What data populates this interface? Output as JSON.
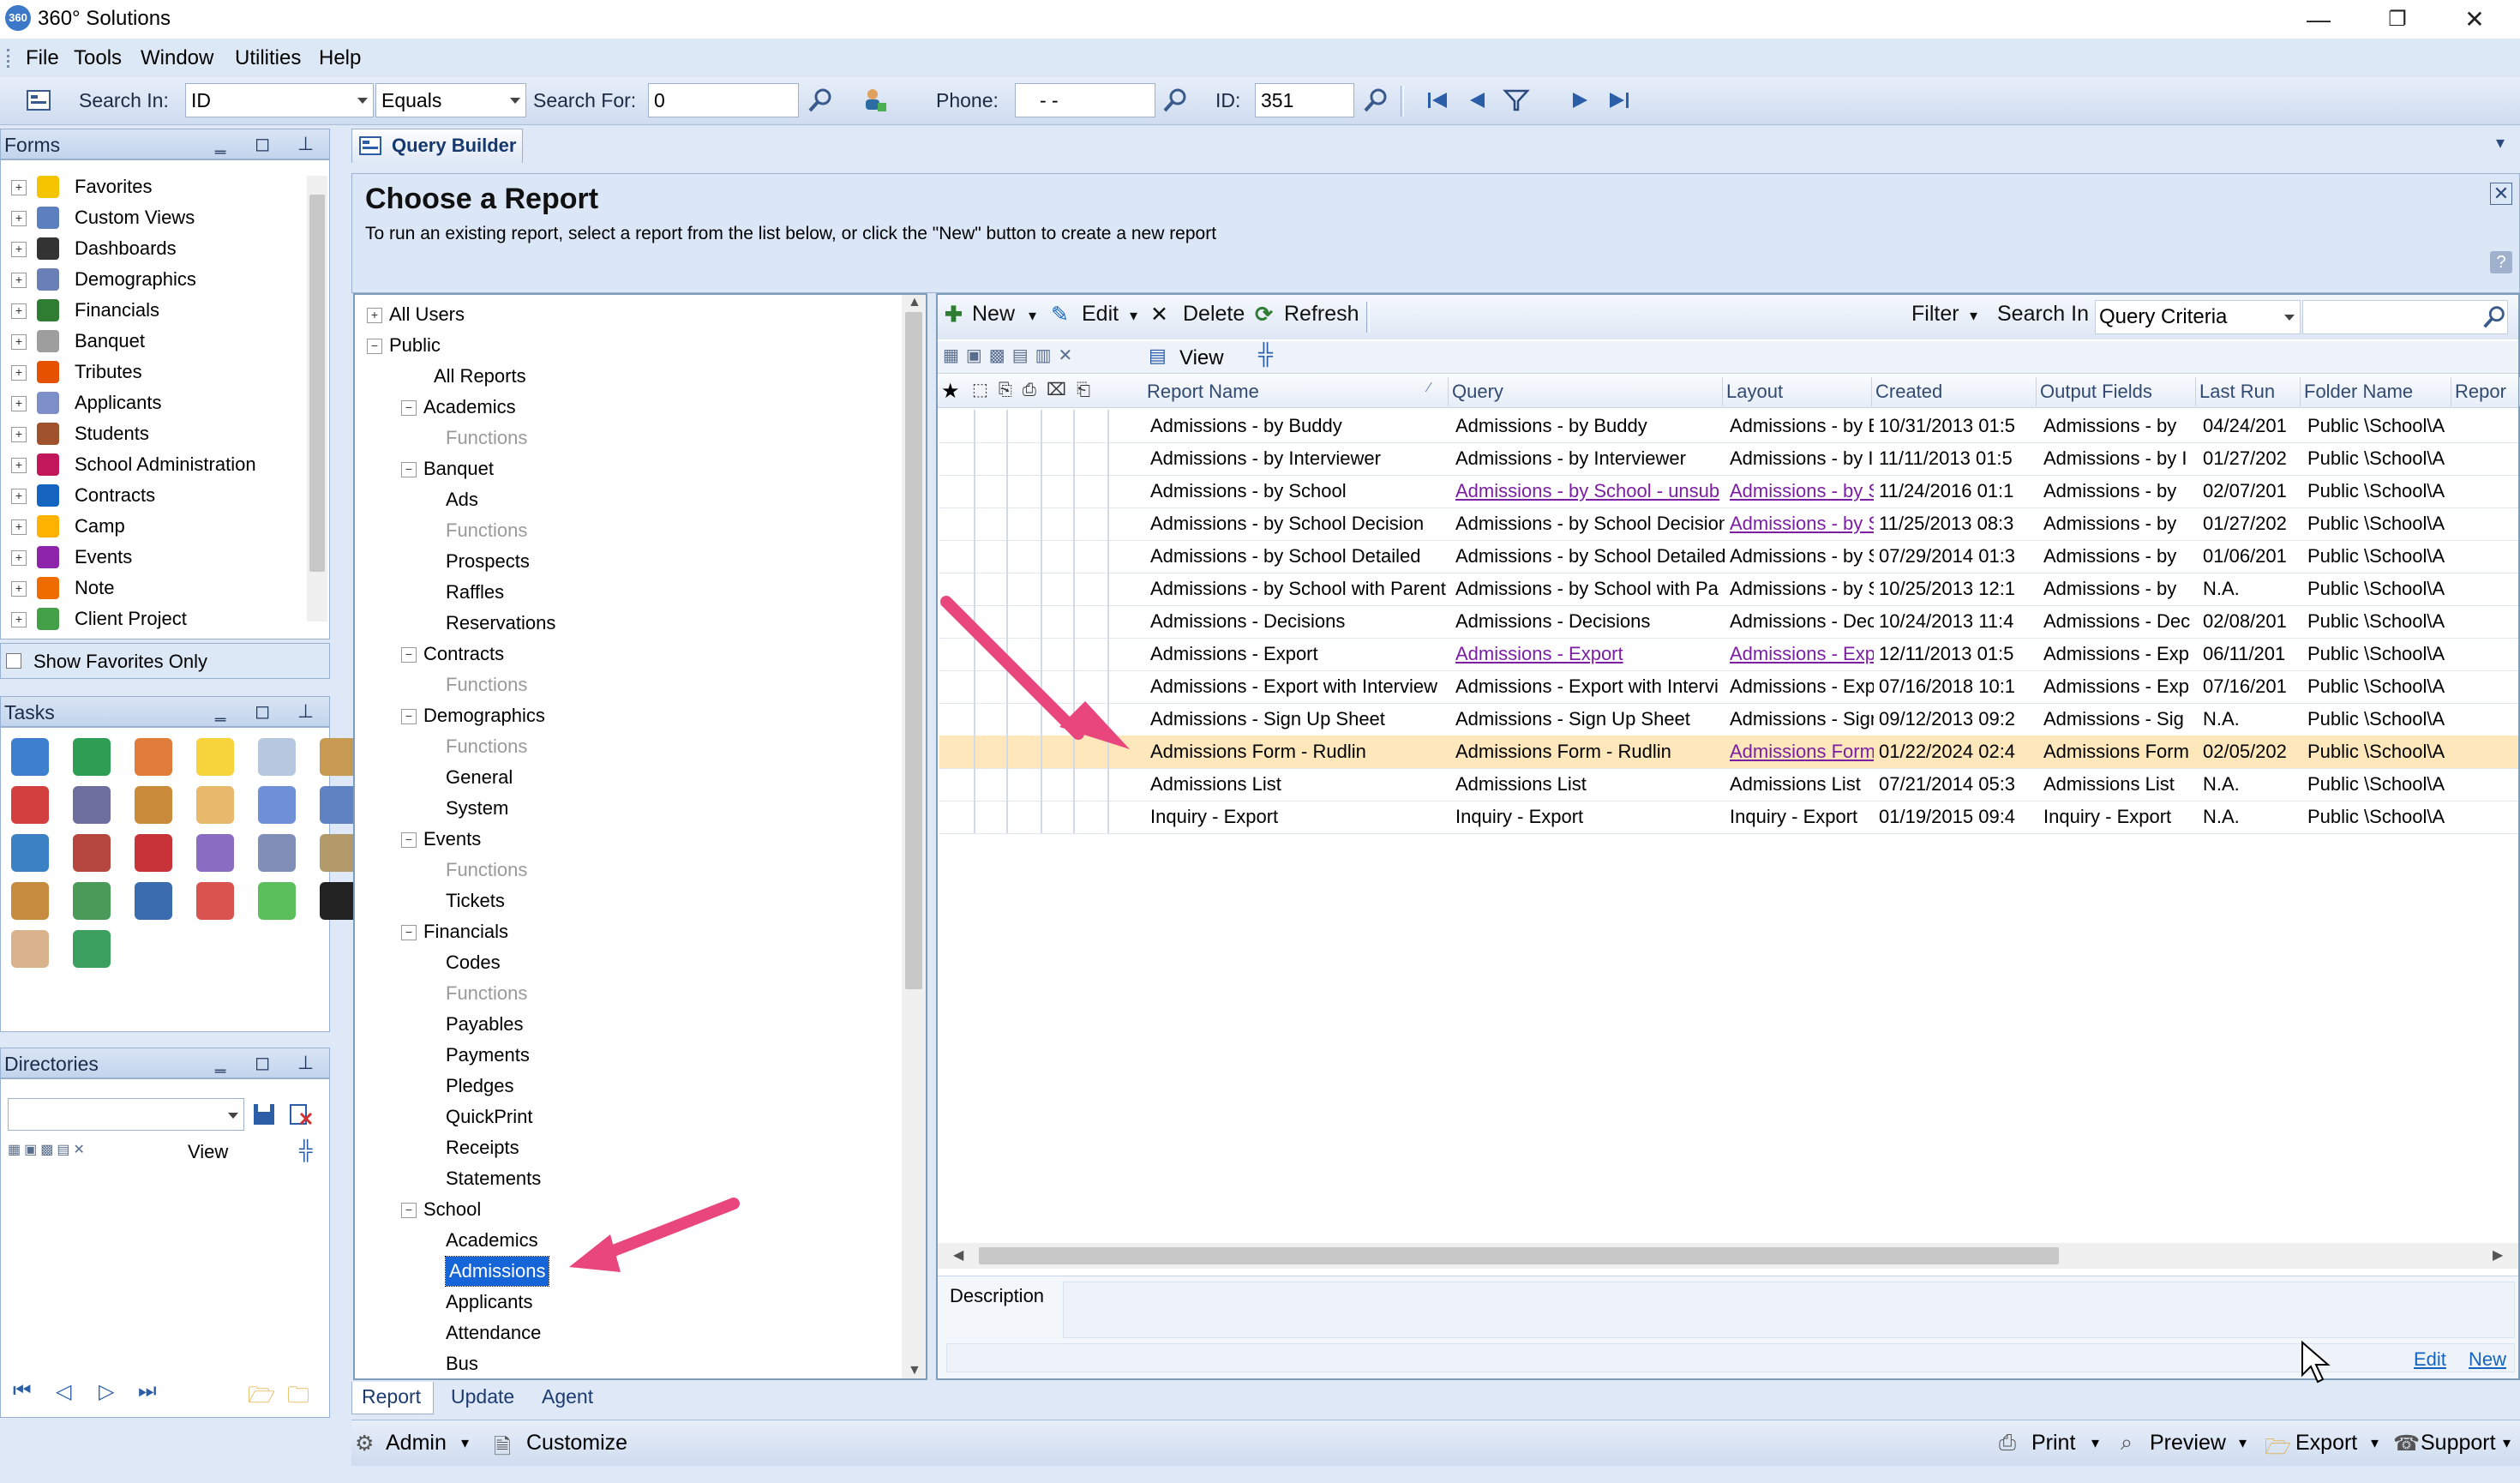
{
  "window": {
    "title": "360° Solutions",
    "minimize": "—",
    "restore": "❐",
    "close": "✕"
  },
  "menu": [
    "File",
    "Tools",
    "Window",
    "Utilities",
    "Help"
  ],
  "toolbar": {
    "search_in_label": "Search In:",
    "search_in_value": "ID",
    "operator_value": "Equals",
    "search_for_label": "Search For:",
    "search_for_value": "0",
    "phone_label": "Phone:",
    "phone_value": "-   -",
    "id_label": "ID:",
    "id_value": "351"
  },
  "forms_panel": {
    "title": "Forms",
    "items": [
      {
        "label": "Favorites",
        "icon": "star-icon",
        "color": "#f5c400"
      },
      {
        "label": "Custom Views",
        "icon": "custom-views-icon",
        "color": "#5b7fbf"
      },
      {
        "label": "Dashboards",
        "icon": "dashboard-icon",
        "color": "#333333"
      },
      {
        "label": "Demographics",
        "icon": "demographics-icon",
        "color": "#6a7fb5"
      },
      {
        "label": "Financials",
        "icon": "dollar-icon",
        "color": "#2e7d32"
      },
      {
        "label": "Banquet",
        "icon": "banquet-icon",
        "color": "#9e9e9e"
      },
      {
        "label": "Tributes",
        "icon": "tributes-icon",
        "color": "#e65100"
      },
      {
        "label": "Applicants",
        "icon": "applicants-icon",
        "color": "#7c8fc9"
      },
      {
        "label": "Students",
        "icon": "students-icon",
        "color": "#a0522d"
      },
      {
        "label": "School Administration",
        "icon": "school-admin-icon",
        "color": "#c2185b"
      },
      {
        "label": "Contracts",
        "icon": "contracts-icon",
        "color": "#1565c0"
      },
      {
        "label": "Camp",
        "icon": "camp-icon",
        "color": "#ffb300"
      },
      {
        "label": "Events",
        "icon": "events-icon",
        "color": "#8e24aa"
      },
      {
        "label": "Note",
        "icon": "note-icon",
        "color": "#ef6c00"
      },
      {
        "label": "Client Project",
        "icon": "client-project-icon",
        "color": "#43a047"
      }
    ],
    "show_favorites_only": "Show Favorites Only"
  },
  "tasks_panel": {
    "title": "Tasks"
  },
  "directories_panel": {
    "title": "Directories",
    "view_label": "View"
  },
  "tab": {
    "label": "Query Builder"
  },
  "chooser": {
    "title": "Choose a Report",
    "subtitle": "To run an existing report, select a report from the list below, or click the \"New\" button to create a new report"
  },
  "tree": [
    {
      "label": "All Users",
      "level": 0,
      "exp": "+"
    },
    {
      "label": "Public",
      "level": 0,
      "exp": "−"
    },
    {
      "label": "All Reports",
      "level": 1,
      "exp": ""
    },
    {
      "label": "Academics",
      "level": 1,
      "exp": "−"
    },
    {
      "label": "Functions",
      "level": 2,
      "exp": "",
      "grey": true
    },
    {
      "label": "Banquet",
      "level": 1,
      "exp": "−"
    },
    {
      "label": "Ads",
      "level": 2,
      "exp": ""
    },
    {
      "label": "Functions",
      "level": 2,
      "exp": "",
      "grey": true
    },
    {
      "label": "Prospects",
      "level": 2,
      "exp": ""
    },
    {
      "label": "Raffles",
      "level": 2,
      "exp": ""
    },
    {
      "label": "Reservations",
      "level": 2,
      "exp": ""
    },
    {
      "label": "Contracts",
      "level": 1,
      "exp": "−"
    },
    {
      "label": "Functions",
      "level": 2,
      "exp": "",
      "grey": true
    },
    {
      "label": "Demographics",
      "level": 1,
      "exp": "−"
    },
    {
      "label": "Functions",
      "level": 2,
      "exp": "",
      "grey": true
    },
    {
      "label": "General",
      "level": 2,
      "exp": ""
    },
    {
      "label": "System",
      "level": 2,
      "exp": ""
    },
    {
      "label": "Events",
      "level": 1,
      "exp": "−"
    },
    {
      "label": "Functions",
      "level": 2,
      "exp": "",
      "grey": true
    },
    {
      "label": "Tickets",
      "level": 2,
      "exp": ""
    },
    {
      "label": "Financials",
      "level": 1,
      "exp": "−"
    },
    {
      "label": "Codes",
      "level": 2,
      "exp": ""
    },
    {
      "label": "Functions",
      "level": 2,
      "exp": "",
      "grey": true
    },
    {
      "label": "Payables",
      "level": 2,
      "exp": ""
    },
    {
      "label": "Payments",
      "level": 2,
      "exp": ""
    },
    {
      "label": "Pledges",
      "level": 2,
      "exp": ""
    },
    {
      "label": "QuickPrint",
      "level": 2,
      "exp": ""
    },
    {
      "label": "Receipts",
      "level": 2,
      "exp": ""
    },
    {
      "label": "Statements",
      "level": 2,
      "exp": ""
    },
    {
      "label": "School",
      "level": 1,
      "exp": "−"
    },
    {
      "label": "Academics",
      "level": 2,
      "exp": ""
    },
    {
      "label": "Admissions",
      "level": 2,
      "exp": "",
      "selected": true
    },
    {
      "label": "Applicants",
      "level": 2,
      "exp": ""
    },
    {
      "label": "Attendance",
      "level": 2,
      "exp": ""
    },
    {
      "label": "Bus",
      "level": 2,
      "exp": ""
    }
  ],
  "grid_toolbar": {
    "new": "New",
    "edit": "Edit",
    "delete": "Delete",
    "refresh": "Refresh",
    "filter": "Filter",
    "search_in": "Search In",
    "search_in_value": "Query Criteria",
    "view": "View"
  },
  "columns": [
    "Report Name",
    "Query",
    "Layout",
    "Created",
    "Output Fields",
    "Last Run",
    "Folder Name",
    "Repor"
  ],
  "rows": [
    [
      "Admissions - by Buddy",
      "Admissions - by Buddy",
      "Admissions - by B",
      "10/31/2013 01:5",
      "Admissions - by",
      "04/24/201",
      "Public \\School\\A"
    ],
    [
      "Admissions - by Interviewer",
      "Admissions - by Interviewer",
      "Admissions - by In",
      "11/11/2013 01:5",
      "Admissions - by I",
      "01/27/202",
      "Public \\School\\A"
    ],
    [
      "Admissions - by School",
      "Admissions - by School - unsub",
      "Admissions - by S",
      "11/24/2016 01:1",
      "Admissions - by",
      "02/07/201",
      "Public \\School\\A"
    ],
    [
      "Admissions - by School Decision",
      "Admissions - by School Decision",
      "Admissions - by S",
      "11/25/2013 08:3",
      "Admissions - by",
      "01/27/202",
      "Public \\School\\A"
    ],
    [
      "Admissions - by School Detailed",
      "Admissions - by School Detailed",
      "Admissions - by S",
      "07/29/2014 01:3",
      "Admissions - by",
      "01/06/201",
      "Public \\School\\A"
    ],
    [
      "Admissions - by School with Parent",
      "Admissions - by School with Pa",
      "Admissions - by S",
      "10/25/2013 12:1",
      "Admissions - by",
      "N.A.",
      "Public \\School\\A"
    ],
    [
      "Admissions - Decisions",
      "Admissions - Decisions",
      "Admissions - Decis",
      "10/24/2013 11:4",
      "Admissions - Dec",
      "02/08/201",
      "Public \\School\\A"
    ],
    [
      "Admissions - Export",
      "Admissions - Export",
      "Admissions - Expo",
      "12/11/2013 01:5",
      "Admissions - Exp",
      "06/11/201",
      "Public \\School\\A"
    ],
    [
      "Admissions - Export with Interview",
      "Admissions - Export with Intervi",
      "Admissions - Exp",
      "07/16/2018 10:1",
      "Admissions - Exp",
      "07/16/201",
      "Public \\School\\A"
    ],
    [
      "Admissions - Sign Up Sheet",
      "Admissions - Sign Up Sheet",
      "Admissions - Sign",
      "09/12/2013 09:2",
      "Admissions - Sig",
      "N.A.",
      "Public \\School\\A"
    ],
    [
      "Admissions Form - Rudlin",
      "Admissions Form - Rudlin",
      "Admissions Form",
      "01/22/2024 02:4",
      "Admissions Form",
      "02/05/202",
      "Public \\School\\A"
    ],
    [
      "Admissions List",
      "Admissions List",
      "Admissions List",
      "07/21/2014 05:3",
      "Admissions List",
      "N.A.",
      "Public \\School\\A"
    ],
    [
      "Inquiry - Export",
      "Inquiry - Export",
      "Inquiry - Export",
      "01/19/2015 09:4",
      "Inquiry - Export",
      "N.A.",
      "Public \\School\\A"
    ]
  ],
  "description_label": "Description",
  "desc_links": {
    "edit": "Edit",
    "new": "New"
  },
  "bottom_tabs": [
    "Report",
    "Update",
    "Agent"
  ],
  "statusbar": {
    "admin": "Admin",
    "customize": "Customize",
    "print": "Print",
    "preview": "Preview",
    "export": "Export",
    "support": "Support"
  },
  "accent": "#e83e8c"
}
